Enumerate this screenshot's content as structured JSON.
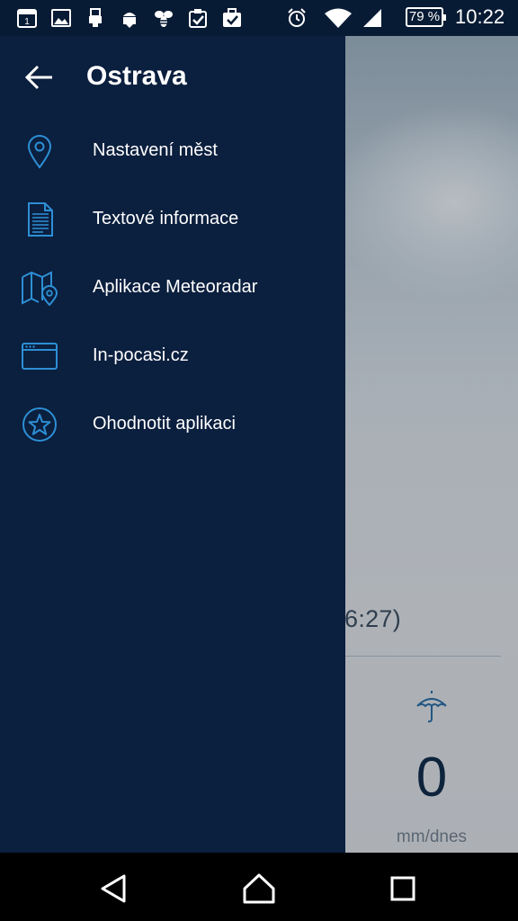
{
  "status_bar": {
    "battery_percent": "79 %",
    "time": "10:22",
    "calendar_day": "1",
    "icons": [
      "calendar-icon",
      "image-icon",
      "usb-icon",
      "android-debug-icon",
      "bee-icon",
      "clipboard-check-icon",
      "briefcase-check-icon",
      "alarm-icon",
      "wifi-icon",
      "signal-icon",
      "battery-icon"
    ]
  },
  "drawer": {
    "title": "Ostrava",
    "items": [
      {
        "label": "Nastavení měst",
        "icon": "location-pin-icon"
      },
      {
        "label": "Textové informace",
        "icon": "document-icon"
      },
      {
        "label": "Aplikace Meteoradar",
        "icon": "map-pin-icon"
      },
      {
        "label": "In-pocasi.cz",
        "icon": "browser-window-icon"
      },
      {
        "label": "Ohodnotit aplikaci",
        "icon": "star-circle-icon"
      }
    ]
  },
  "background": {
    "time_fragment": "6:27)",
    "precip_value": "0",
    "precip_unit": "mm/dnes"
  },
  "colors": {
    "drawer_bg": "#0b1f3e",
    "status_bar_bg": "#081b34",
    "accent_icon": "#2d8fd5"
  },
  "nav_bar": {
    "icons": [
      "back-triangle-icon",
      "home-icon",
      "recents-square-icon"
    ]
  }
}
